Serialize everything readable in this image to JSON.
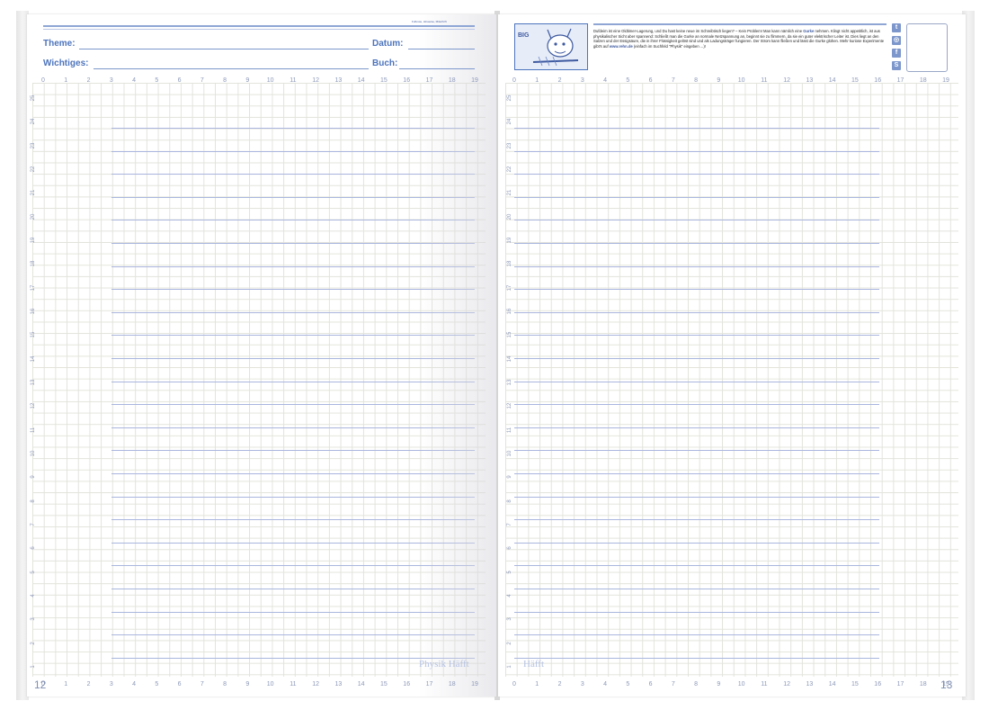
{
  "left_page": {
    "tiny_note": "Fußnote, Hinweise, Mitschrift",
    "fields": [
      {
        "label": "Theme:",
        "id": "theme"
      },
      {
        "label": "Datum:",
        "id": "datum"
      },
      {
        "label": "Wichtiges:",
        "id": "wichtiges"
      },
      {
        "label": "Buch:",
        "id": "buch"
      }
    ],
    "page_number": "12",
    "watermark": "Physik Häfft"
  },
  "right_page": {
    "promo_text_parts": [
      "Dufdeim ist eine Oldtimer-Lagerung, und Du hast keine neue im Schreibtisch liegen? – Kein Problem! Man kann nämlich eine ",
      "Gurke",
      " nehmen. Klingt nicht appetitlich, ist aus physikalischer Sicht aber spannend: Schließt man die Gurke an normale Netzspannung an, beginnt sie zu flimmern, da sie ein guter elektrischer Leiter ist. Dies liegt an den Salzen und der Essigsäure, die in ihrer Flüssigkeit gelöst sind und als Ladungsträger fungieren. Der Strom kann fließen und lässt die Gurke glühen. Mehr kuriose Experimente gibt's auf ",
      "www.rehn.de",
      " (einfach im Suchfeld \"Physik\" eingeben ...)!"
    ],
    "promo_badge": "BIG",
    "social_icons": [
      "twitter-icon",
      "instagram-icon",
      "facebook-icon",
      "skype-icon"
    ],
    "page_number": "13",
    "watermark": "Häfft"
  },
  "axis": {
    "x_ticks": [
      "0",
      "1",
      "2",
      "3",
      "4",
      "5",
      "6",
      "7",
      "8",
      "9",
      "10",
      "11",
      "12",
      "13",
      "14",
      "15",
      "16",
      "17",
      "18",
      "19"
    ],
    "y_ticks": [
      "25",
      "24",
      "23",
      "22",
      "21",
      "20",
      "19",
      "18",
      "17",
      "16",
      "15",
      "14",
      "13",
      "12",
      "11",
      "10",
      "9",
      "8",
      "7",
      "6",
      "5",
      "4",
      "3",
      "2",
      "1"
    ]
  },
  "colors": {
    "accent": "#4d74bd",
    "rule": "#aab6de",
    "grid": "#e3e3dc"
  }
}
